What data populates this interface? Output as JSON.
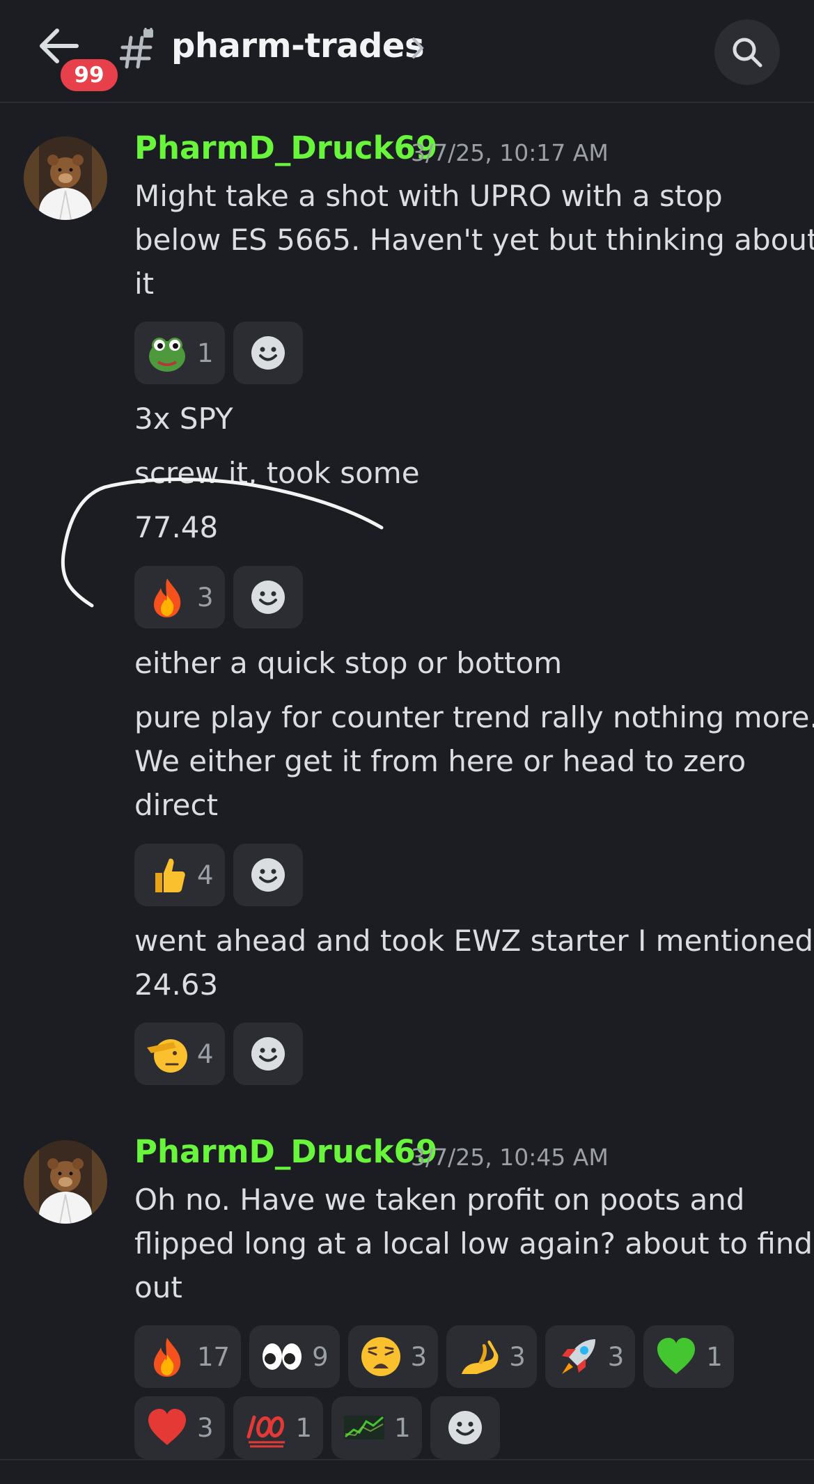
{
  "header": {
    "unread_badge": "99",
    "channel_name": "pharm-trades"
  },
  "messages": [
    {
      "author": "PharmD_Druck69",
      "timestamp": "3/7/25, 10:17 AM",
      "blocks": {
        "b1": [
          "Might take a shot with UPRO with a stop",
          "below ES 5665. Haven't yet but thinking about",
          "it"
        ],
        "b2": [
          "3x SPY"
        ],
        "b3": [
          "screw it, took some"
        ],
        "b4": [
          "77.48"
        ],
        "b5": [
          "either a quick stop or bottom"
        ],
        "b6": [
          "pure play for counter trend rally nothing more.",
          "We either get it from here or head to zero",
          "direct"
        ],
        "b7": [
          "went ahead and took EWZ starter I mentioned",
          "24.63"
        ]
      },
      "reactions": {
        "r1": [
          {
            "icon": "frog-emoji-icon",
            "count": "1"
          }
        ],
        "r2": [
          {
            "icon": "fire-emoji-icon",
            "count": "3"
          }
        ],
        "r3": [
          {
            "icon": "thumbs-up-emoji-icon",
            "count": "4"
          }
        ],
        "r4": [
          {
            "icon": "saluting-face-emoji-icon",
            "count": "4"
          }
        ]
      }
    },
    {
      "author": "PharmD_Druck69",
      "timestamp": "3/7/25, 10:45 AM",
      "blocks": {
        "b1": [
          "Oh no. Have we taken profit on poots and",
          "flipped long at a local low again? about to find",
          "out"
        ]
      },
      "reactions": {
        "row1": [
          {
            "icon": "fire-emoji-icon",
            "count": "17"
          },
          {
            "icon": "eyes-emoji-icon",
            "count": "9"
          },
          {
            "icon": "weary-face-emoji-icon",
            "count": "3"
          },
          {
            "icon": "pinching-hand-emoji-icon",
            "count": "3"
          },
          {
            "icon": "rocket-emoji-icon",
            "count": "3"
          },
          {
            "icon": "green-heart-emoji-icon",
            "count": "1"
          }
        ],
        "row2": [
          {
            "icon": "red-heart-emoji-icon",
            "count": "3"
          },
          {
            "icon": "hundred-points-emoji-icon",
            "count": "1"
          },
          {
            "icon": "chart-emoji-icon",
            "count": "1"
          }
        ]
      }
    }
  ],
  "colors": {
    "background": "#1c1d23",
    "author": "#69f53b",
    "pill": "#2b2d33",
    "badge": "#e7404a"
  }
}
